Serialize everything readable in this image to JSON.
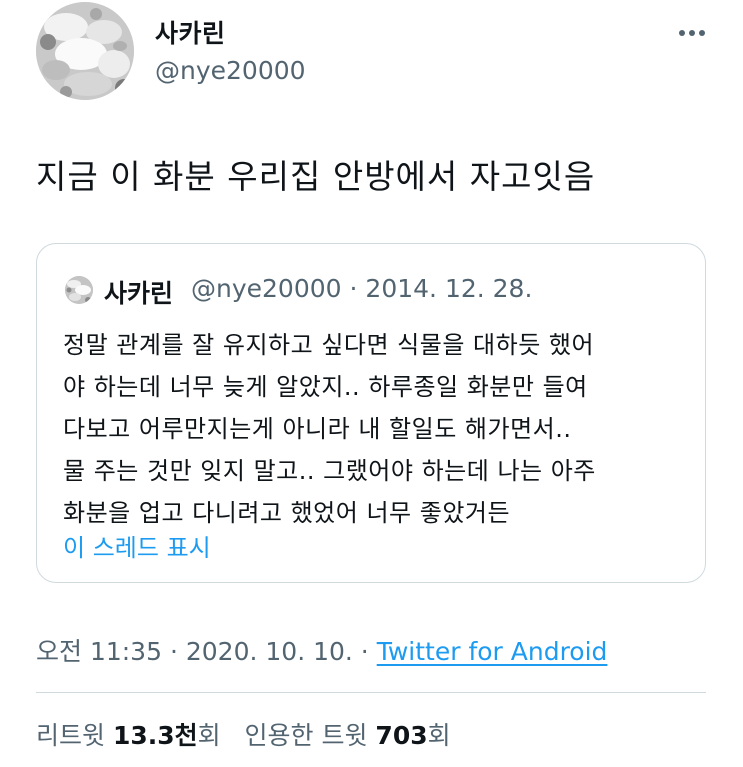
{
  "author": {
    "display_name": "사카린",
    "handle": "@nye20000"
  },
  "tweet": {
    "text": "지금 이 화분 우리집 안방에서 자고잇음"
  },
  "quoted_tweet": {
    "display_name": "사카린",
    "handle": "@nye20000",
    "separator": "·",
    "date": "2014. 12. 28.",
    "lines": [
      "정말 관계를 잘 유지하고 싶다면 식물을 대하듯 했어",
      "야 하는데 너무 늦게 알았지.. 하루종일 화분만 들여",
      "다보고 어루만지는게 아니라 내 할일도 해가면서..",
      "물 주는 것만 잊지 말고.. 그랬어야 하는데 나는 아주",
      "화분을 업고 다니려고 했었어 너무 좋았거든"
    ],
    "show_thread_label": "이 스레드 표시"
  },
  "meta": {
    "time": "오전 11:35",
    "separator": "·",
    "date": "2020. 10. 10.",
    "source": "Twitter for Android"
  },
  "stats": {
    "retweets_label": "리트윗",
    "retweets_count": "13.3천",
    "retweets_suffix": "회",
    "quotes_label": "인용한 트윗",
    "quotes_count": "703",
    "quotes_suffix": "회"
  },
  "icons": {
    "more": "more-horizontal-icon"
  },
  "colors": {
    "link": "#1d9bf0",
    "secondary_text": "#536471",
    "border": "#cfd9de"
  }
}
